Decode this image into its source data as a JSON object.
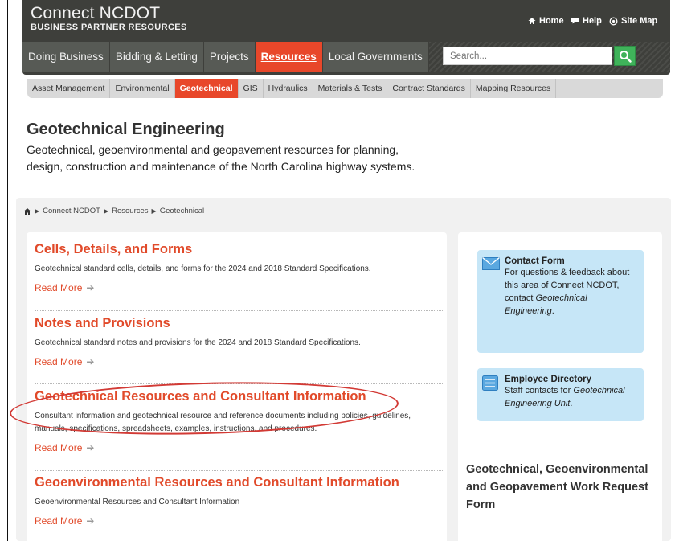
{
  "header": {
    "brand_title": "Connect NCDOT",
    "brand_subtitle": "BUSINESS PARTNER RESOURCES",
    "utility": [
      {
        "label": "Home",
        "icon": "home-icon"
      },
      {
        "label": "Help",
        "icon": "chat-icon"
      },
      {
        "label": "Site Map",
        "icon": "sitemap-icon"
      }
    ],
    "nav": [
      {
        "label": "Doing Business"
      },
      {
        "label": "Bidding & Letting"
      },
      {
        "label": "Projects"
      },
      {
        "label": "Resources",
        "active": true
      },
      {
        "label": "Local Governments"
      }
    ],
    "search_placeholder": "Search..."
  },
  "subnav": [
    {
      "label": "Asset Management"
    },
    {
      "label": "Environmental"
    },
    {
      "label": "Geotechnical",
      "active": true
    },
    {
      "label": "GIS"
    },
    {
      "label": "Hydraulics"
    },
    {
      "label": "Materials & Tests"
    },
    {
      "label": "Contract Standards"
    },
    {
      "label": "Mapping Resources"
    }
  ],
  "page": {
    "title": "Geotechnical Engineering",
    "intro": "Geotechnical, geoenvironmental and geopavement resources for planning, design, construction and maintenance of the North Carolina highway systems."
  },
  "breadcrumb": [
    "Connect NCDOT",
    "Resources",
    "Geotechnical"
  ],
  "sections": [
    {
      "title": "Cells, Details, and Forms",
      "desc": "Geotechnical standard cells, details, and forms for the 2024 and 2018 Standard Specifications.",
      "read_more": "Read More"
    },
    {
      "title": "Notes and Provisions",
      "desc": "Geotechnical standard notes and provisions for the 2024 and 2018 Standard Specifications.",
      "read_more": "Read More"
    },
    {
      "title": "Geotechnical Resources and Consultant Information",
      "desc": "Consultant information and geotechnical resource and reference documents including policies, guidelines, manuals, specifications, spreadsheets, examples, instructions, and procedures.",
      "read_more": "Read More"
    },
    {
      "title": "Geoenvironmental Resources and Consultant Information",
      "desc": "Geoenvironmental Resources and Consultant Information",
      "read_more": "Read More"
    }
  ],
  "sidebar": {
    "contact": {
      "title": "Contact Form",
      "text_before": "For questions & feedback about this area of Connect NCDOT, contact ",
      "text_em": "Geotechnical Engineering",
      "text_after": "."
    },
    "directory": {
      "title": "Employee Directory",
      "text_before": "Staff contacts for ",
      "text_em": "Geotechnical Engineering Unit",
      "text_after": "."
    },
    "work_request_title": "Geotechnical, Geoenvironmental and Geopavement Work Request Form"
  },
  "colors": {
    "accent": "#e8472a",
    "header": "#3e3f3b",
    "card": "#c6e6f7",
    "annotation": "#d23a35"
  }
}
